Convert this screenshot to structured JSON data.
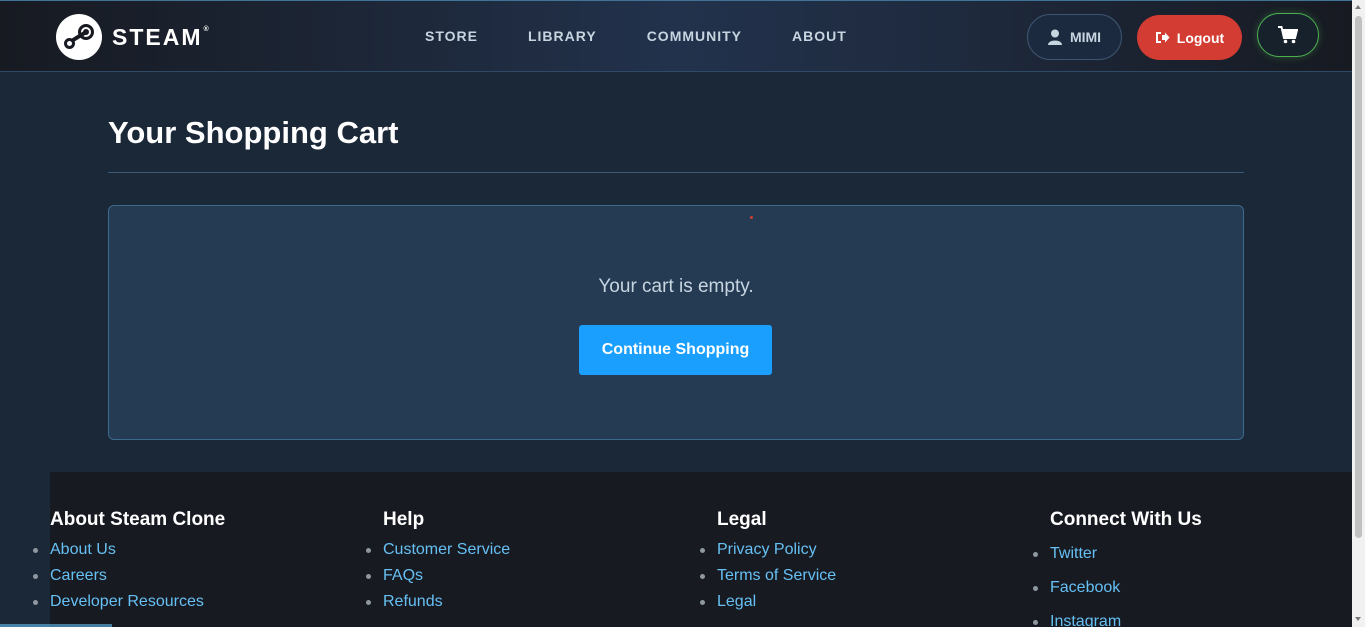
{
  "header": {
    "logo_text": "STEAM",
    "logo_mark": "®",
    "nav": [
      {
        "label": "STORE"
      },
      {
        "label": "LIBRARY"
      },
      {
        "label": "COMMUNITY"
      },
      {
        "label": "ABOUT"
      }
    ],
    "user_label": "MIMI",
    "logout_label": "Logout",
    "cart_icon": "cart-icon"
  },
  "main": {
    "title": "Your Shopping Cart",
    "empty_message": "Your cart is empty.",
    "continue_label": "Continue Shopping"
  },
  "footer": {
    "columns": [
      {
        "heading": "About Steam Clone",
        "links": [
          "About Us",
          "Careers",
          "Developer Resources"
        ]
      },
      {
        "heading": "Help",
        "links": [
          "Customer Service",
          "FAQs",
          "Refunds"
        ]
      },
      {
        "heading": "Legal",
        "links": [
          "Privacy Policy",
          "Terms of Service",
          "Legal"
        ]
      },
      {
        "heading": "Connect With Us",
        "links": [
          "Twitter",
          "Facebook",
          "Instagram"
        ]
      }
    ]
  },
  "colors": {
    "accent": "#1a9fff",
    "logout": "#d23c33",
    "link": "#66c0f4",
    "background": "#1b2838"
  }
}
